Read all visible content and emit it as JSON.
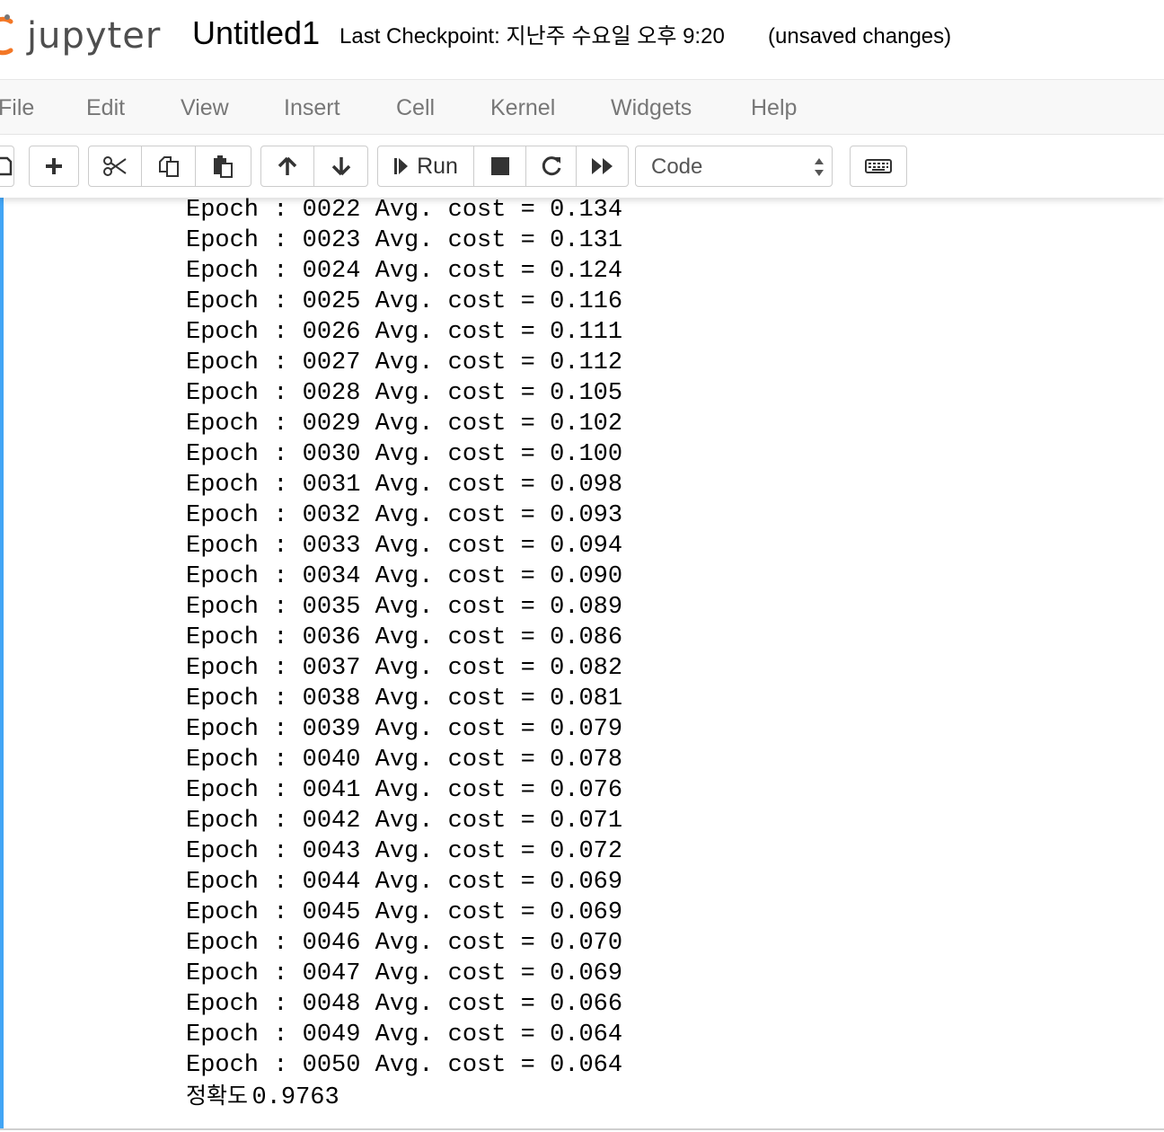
{
  "header": {
    "logo_text": "jupyter",
    "notebook_name": "Untitled1",
    "checkpoint_text": "Last Checkpoint: 지난주 수요일 오후 9:20",
    "autosave_status": "(unsaved changes)"
  },
  "menubar": {
    "items": [
      "File",
      "Edit",
      "View",
      "Insert",
      "Cell",
      "Kernel",
      "Widgets",
      "Help"
    ]
  },
  "toolbar": {
    "run_label": "Run",
    "cell_type": "Code",
    "icons": [
      "save-icon",
      "plus-icon",
      "scissors-icon",
      "copy-icon",
      "paste-icon",
      "arrow-up-icon",
      "arrow-down-icon",
      "step-forward-icon",
      "stop-icon",
      "refresh-icon",
      "fast-forward-icon",
      "keyboard-icon"
    ]
  },
  "output": {
    "lines": [
      "Epoch : 0022 Avg. cost = 0.134",
      "Epoch : 0023 Avg. cost = 0.131",
      "Epoch : 0024 Avg. cost = 0.124",
      "Epoch : 0025 Avg. cost = 0.116",
      "Epoch : 0026 Avg. cost = 0.111",
      "Epoch : 0027 Avg. cost = 0.112",
      "Epoch : 0028 Avg. cost = 0.105",
      "Epoch : 0029 Avg. cost = 0.102",
      "Epoch : 0030 Avg. cost = 0.100",
      "Epoch : 0031 Avg. cost = 0.098",
      "Epoch : 0032 Avg. cost = 0.093",
      "Epoch : 0033 Avg. cost = 0.094",
      "Epoch : 0034 Avg. cost = 0.090",
      "Epoch : 0035 Avg. cost = 0.089",
      "Epoch : 0036 Avg. cost = 0.086",
      "Epoch : 0037 Avg. cost = 0.082",
      "Epoch : 0038 Avg. cost = 0.081",
      "Epoch : 0039 Avg. cost = 0.079",
      "Epoch : 0040 Avg. cost = 0.078",
      "Epoch : 0041 Avg. cost = 0.076",
      "Epoch : 0042 Avg. cost = 0.071",
      "Epoch : 0043 Avg. cost = 0.072",
      "Epoch : 0044 Avg. cost = 0.069",
      "Epoch : 0045 Avg. cost = 0.069",
      "Epoch : 0046 Avg. cost = 0.070",
      "Epoch : 0047 Avg. cost = 0.069",
      "Epoch : 0048 Avg. cost = 0.066",
      "Epoch : 0049 Avg. cost = 0.064",
      "Epoch : 0050 Avg. cost = 0.064"
    ],
    "accuracy_label": "정확도",
    "accuracy_value": "0.9763"
  },
  "colors": {
    "logo_orange": "#f37726",
    "cell_selected_bar": "#42a5f5",
    "menu_text": "#777777",
    "menubar_bg": "#f8f8f8"
  }
}
